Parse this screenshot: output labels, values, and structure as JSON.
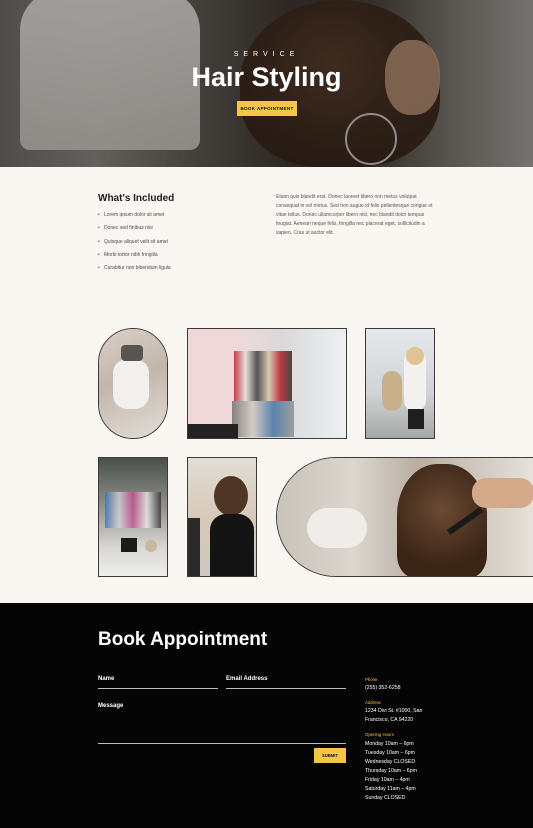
{
  "hero": {
    "eyebrow": "SERVICE",
    "title": "Hair Styling",
    "button_label": "BOOK APPOINTMENT"
  },
  "included": {
    "title": "What's Included",
    "items": [
      "Lorem ipsum dolor sit amet",
      "Donec sed finibus nisi",
      "Quisque aliquet velit sit amet",
      "Morbi tortor nibh fringilla",
      "Curabitur non bibendum ligula"
    ],
    "paragraph": "Etiam quis blandit erat. Donec laoreet libero non metus volutpat consequat in vel metus. Sed non augue id felis pellentesque congue et vitae tellus. Donec ullamcorper libero nisl, nec blandit dolor tempus feugiat. Aenean neque felis, fringilla nec placerat eget, sollicitudin a sapien. Cras ut auctor elit."
  },
  "form": {
    "title": "Book Appointment",
    "name_label": "Name",
    "email_label": "Email Address",
    "message_label": "Message",
    "submit_label": "SUBMIT"
  },
  "contact": {
    "phone_label": "Phone",
    "phone": "(255) 352-6258",
    "address_label": "Address",
    "address": "1234 Divi St. #1000, San Francisco, CA 94220",
    "hours_label": "Opening Hours",
    "hours": [
      "Monday 10am – 6pm",
      "Tuesday 10am – 6pm",
      "Wednesday CLOSED",
      "Thursday 10am – 6pm",
      "Friday 10am – 4pm",
      "Saturday 11am – 4pm",
      "Sunday CLOSED"
    ]
  },
  "colors": {
    "accent": "#f4c547",
    "footer_bg": "#050505",
    "page_bg": "#faf7f3"
  }
}
